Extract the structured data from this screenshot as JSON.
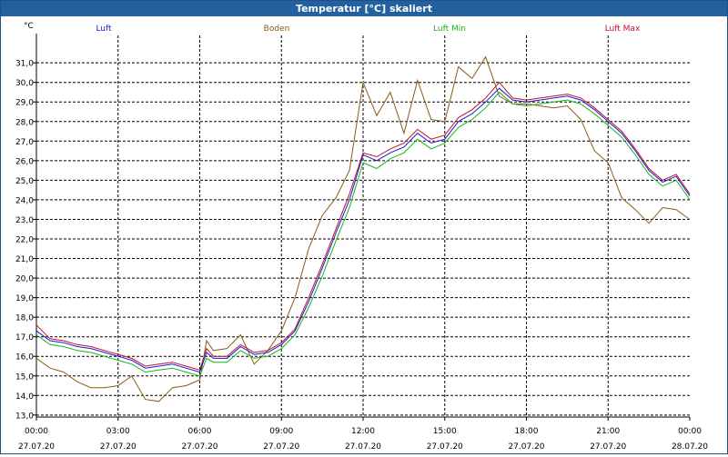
{
  "window": {
    "title": "Temperatur [°C] skaliert"
  },
  "chart_data": {
    "type": "line",
    "title": "Temperatur [°C] skaliert",
    "ylabel": "°C",
    "xlabel": "",
    "ylim": [
      12.9,
      32.4
    ],
    "xlim": [
      0,
      24
    ],
    "y_ticks": [
      "13,0",
      "14,0",
      "15,0",
      "16,0",
      "17,0",
      "18,0",
      "19,0",
      "20,0",
      "21,0",
      "22,0",
      "23,0",
      "24,0",
      "25,0",
      "26,0",
      "27,0",
      "28,0",
      "29,0",
      "30,0",
      "31,0"
    ],
    "y_tick_values": [
      13,
      14,
      15,
      16,
      17,
      18,
      19,
      20,
      21,
      22,
      23,
      24,
      25,
      26,
      27,
      28,
      29,
      30,
      31
    ],
    "x_ticks": [
      {
        "hours": 0,
        "time": "00:00",
        "date": "27.07.20"
      },
      {
        "hours": 3,
        "time": "03:00",
        "date": "27.07.20"
      },
      {
        "hours": 6,
        "time": "06:00",
        "date": "27.07.20"
      },
      {
        "hours": 9,
        "time": "09:00",
        "date": "27.07.20"
      },
      {
        "hours": 12,
        "time": "12:00",
        "date": "27.07.20"
      },
      {
        "hours": 15,
        "time": "15:00",
        "date": "27.07.20"
      },
      {
        "hours": 18,
        "time": "18:00",
        "date": "27.07.20"
      },
      {
        "hours": 21,
        "time": "21:00",
        "date": "27.07.20"
      },
      {
        "hours": 24,
        "time": "00:00",
        "date": "28.07.20"
      }
    ],
    "grid": true,
    "legend_position": "top",
    "x": [
      0,
      0.5,
      1,
      1.5,
      2,
      2.5,
      3,
      3.5,
      4,
      4.5,
      5,
      5.5,
      6,
      6.25,
      6.5,
      7,
      7.5,
      8,
      8.5,
      9,
      9.5,
      10,
      10.5,
      11,
      11.5,
      12,
      12.5,
      13,
      13.5,
      14,
      14.5,
      15,
      15.5,
      16,
      16.5,
      17,
      17.5,
      18,
      18.5,
      19,
      19.5,
      20,
      20.5,
      21,
      21.5,
      22,
      22.5,
      23,
      23.5,
      24
    ],
    "series": [
      {
        "name": "Luft",
        "color": "#1a1ad0",
        "values": [
          17.3,
          16.8,
          16.7,
          16.5,
          16.4,
          16.2,
          16.0,
          15.8,
          15.4,
          15.5,
          15.6,
          15.4,
          15.2,
          16.2,
          15.9,
          15.9,
          16.5,
          16.1,
          16.2,
          16.6,
          17.3,
          18.8,
          20.5,
          22.3,
          24.0,
          26.3,
          26.0,
          26.4,
          26.7,
          27.4,
          26.9,
          27.1,
          28.0,
          28.4,
          29.0,
          29.7,
          29.1,
          29.0,
          29.1,
          29.2,
          29.3,
          29.1,
          28.6,
          28.0,
          27.4,
          26.5,
          25.5,
          24.9,
          25.2,
          24.2
        ]
      },
      {
        "name": "Boden",
        "color": "#8a5a12",
        "values": [
          15.9,
          15.4,
          15.2,
          14.7,
          14.4,
          14.4,
          14.5,
          15.0,
          13.8,
          13.7,
          14.4,
          14.5,
          14.8,
          16.8,
          16.3,
          16.4,
          17.1,
          15.6,
          16.3,
          17.3,
          19.0,
          21.5,
          23.2,
          24.1,
          25.5,
          30.0,
          28.3,
          29.5,
          27.4,
          30.1,
          28.1,
          28.0,
          30.8,
          30.2,
          31.3,
          29.3,
          28.9,
          28.9,
          28.8,
          28.7,
          28.8,
          28.1,
          26.5,
          25.9,
          24.1,
          23.5,
          22.8,
          23.6,
          23.5,
          23.0
        ]
      },
      {
        "name": "Luft Min",
        "color": "#18b418",
        "values": [
          17.1,
          16.6,
          16.5,
          16.3,
          16.2,
          16.0,
          15.8,
          15.6,
          15.2,
          15.3,
          15.4,
          15.2,
          15.0,
          15.9,
          15.7,
          15.7,
          16.3,
          15.9,
          16.0,
          16.4,
          17.1,
          18.5,
          20.1,
          21.9,
          23.6,
          25.9,
          25.6,
          26.1,
          26.4,
          27.1,
          26.6,
          26.9,
          27.7,
          28.1,
          28.7,
          29.5,
          28.9,
          28.8,
          28.9,
          29.0,
          29.1,
          28.9,
          28.4,
          27.8,
          27.2,
          26.3,
          25.3,
          24.7,
          25.0,
          24.0
        ]
      },
      {
        "name": "Luft Max",
        "color": "#c01028",
        "values": [
          17.6,
          16.9,
          16.8,
          16.6,
          16.5,
          16.3,
          16.1,
          15.9,
          15.5,
          15.6,
          15.7,
          15.5,
          15.3,
          16.4,
          16.0,
          16.0,
          16.6,
          16.2,
          16.3,
          16.7,
          17.4,
          19.0,
          20.7,
          22.5,
          24.3,
          26.4,
          26.2,
          26.6,
          26.9,
          27.6,
          27.1,
          27.3,
          28.2,
          28.6,
          29.2,
          30.0,
          29.2,
          29.1,
          29.2,
          29.3,
          29.4,
          29.2,
          28.7,
          28.1,
          27.5,
          26.6,
          25.6,
          25.0,
          25.3,
          24.3
        ]
      }
    ]
  }
}
